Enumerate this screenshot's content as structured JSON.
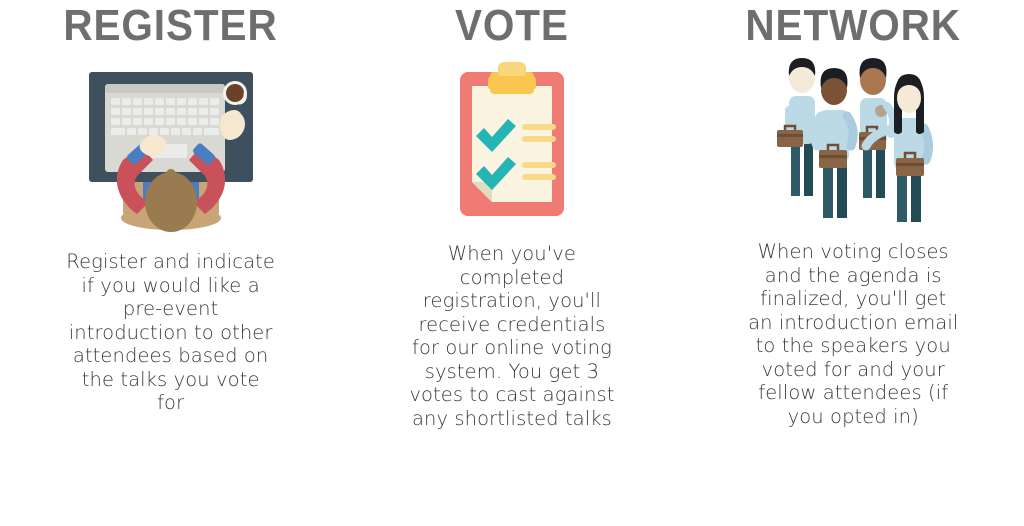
{
  "page": {
    "background": "#ffffff",
    "heading_color": "#6e6e6e",
    "body_color": "#3a3a3a"
  },
  "columns": [
    {
      "id": "register",
      "heading": "REGISTER",
      "illustration": "person-at-laptop-icon",
      "body": "Register and indicate if you would like a pre-event introduction to other attendees based on the talks you vote for",
      "colors": {
        "desk": "#3e4f5e",
        "keyboard": "#d9d9d4",
        "sleeve": "#c9515a",
        "cuff": "#4a7ec0",
        "skin": "#f6e7cf",
        "hair": "#9a7b4f",
        "chair": "#c9a477",
        "shirt": "#4a7ec0",
        "coffee": "#6b4226"
      }
    },
    {
      "id": "vote",
      "heading": "VOTE",
      "illustration": "clipboard-checklist-icon",
      "body": "When you've completed registration, you'll receive credentials for our online voting system. You get 3 votes to cast against any shortlisted talks",
      "colors": {
        "board": "#ef7b74",
        "paper": "#faf4e0",
        "clip": "#f9c650",
        "clip_top": "#f7d77a",
        "check": "#25b5b5",
        "line": "#fad98a",
        "fold": "#e8e6cc"
      }
    },
    {
      "id": "network",
      "heading": "NETWORK",
      "illustration": "group-of-professionals-icon",
      "body": "When voting closes and the agenda is finalized, you'll get an introduction email to the speakers you voted for and your fellow attendees (if you opted in)",
      "colors": {
        "shirt": "#bcd9e6",
        "shirt_shade": "#a9cdde",
        "pants": "#2d5a66",
        "pants_dark": "#234b56",
        "hair": "#1b1f24",
        "skin_light": "#f4ead7",
        "skin_mid": "#a9764f",
        "skin_dark": "#7a5236",
        "case": "#8a6446",
        "case_dark": "#6e4f36"
      }
    }
  ]
}
